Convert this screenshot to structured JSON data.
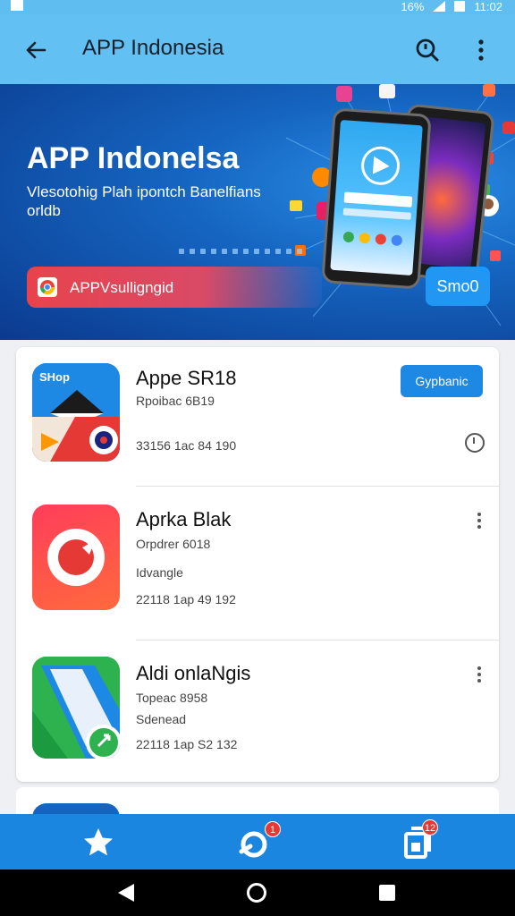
{
  "status_bar": {
    "battery": "16%",
    "time": "11:02"
  },
  "app_bar": {
    "title": "APP Indonesia",
    "icons": [
      "back-arrow-icon",
      "search-icon",
      "more-vert-icon"
    ]
  },
  "banner": {
    "title": "APP Indonelsa",
    "subtitle": "Vlesotohig Plah ipontch Banelfians orldb",
    "pill_text": "APPVsulligngid",
    "button": "Smo0"
  },
  "apps": [
    {
      "name": "Appe SR18",
      "line1": "Rpoibac 6B19",
      "line2": "",
      "meta": "33156 1ac 84 190",
      "action": "Gypbanic"
    },
    {
      "name": "Aprka Blak",
      "line1": "Orpdrer 6018",
      "line2": "Idvangle",
      "meta": "22118 1ap 49 192"
    },
    {
      "name": "Aldi onlaNgis",
      "line1": "Topeac 8958",
      "line2": "Sdenead",
      "meta": "22118 1ap S2 132"
    }
  ],
  "bottom_nav": {
    "items": [
      "favorites",
      "messages",
      "library"
    ],
    "badges": {
      "messages": "1",
      "library": "12"
    }
  },
  "colors": {
    "app_bar": "#62c0f2",
    "accent": "#1e88e5",
    "nav": "#1a86e0"
  }
}
